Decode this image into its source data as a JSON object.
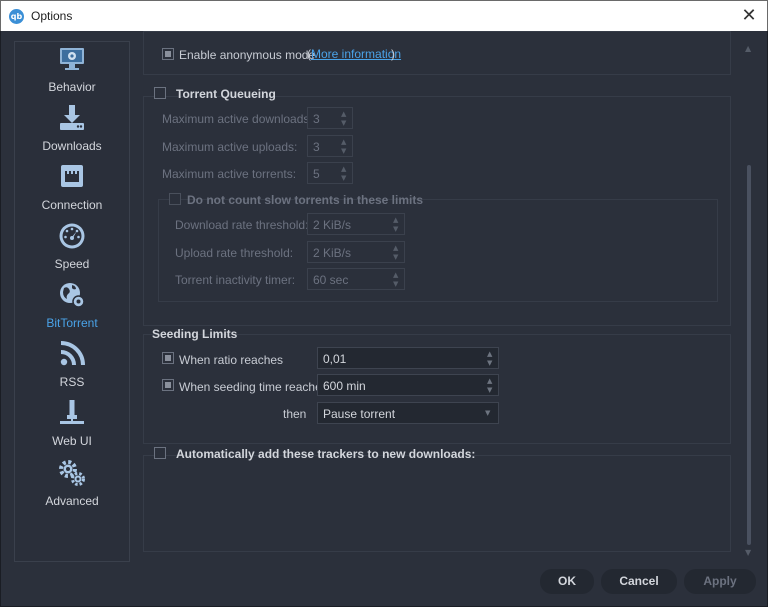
{
  "window": {
    "title": "Options",
    "app_icon_text": "qb",
    "close_glyph": "✕"
  },
  "sidebar": {
    "items": [
      {
        "label": "Behavior",
        "icon": "monitor-gear-icon",
        "active": false
      },
      {
        "label": "Downloads",
        "icon": "download-tray-icon",
        "active": false
      },
      {
        "label": "Connection",
        "icon": "network-port-icon",
        "active": false
      },
      {
        "label": "Speed",
        "icon": "speedometer-icon",
        "active": false
      },
      {
        "label": "BitTorrent",
        "icon": "globe-gear-icon",
        "active": true
      },
      {
        "label": "RSS",
        "icon": "rss-icon",
        "active": false
      },
      {
        "label": "Web UI",
        "icon": "web-ui-plug-icon",
        "active": false
      },
      {
        "label": "Advanced",
        "icon": "gears-icon",
        "active": false
      }
    ],
    "active_color": "#4aa3e8"
  },
  "privacy": {
    "anonymous_mode_label": "Enable anonymous mode",
    "anonymous_mode_checked": true,
    "open_paren": "(",
    "more_info_link": "More information",
    "close_paren": ")"
  },
  "queueing": {
    "title": "Torrent Queueing",
    "checked": false,
    "max_downloads_label": "Maximum active downloads:",
    "max_downloads_value": "3",
    "max_uploads_label": "Maximum active uploads:",
    "max_uploads_value": "3",
    "max_torrents_label": "Maximum active torrents:",
    "max_torrents_value": "5",
    "slow": {
      "title": "Do not count slow torrents in these limits",
      "checked": false,
      "download_rate_label": "Download rate threshold:",
      "download_rate_value": "2 KiB/s",
      "upload_rate_label": "Upload rate threshold:",
      "upload_rate_value": "2 KiB/s",
      "inactivity_label": "Torrent inactivity timer:",
      "inactivity_value": "60 sec"
    }
  },
  "seeding": {
    "title": "Seeding Limits",
    "ratio_label": "When ratio reaches",
    "ratio_checked": true,
    "ratio_value": "0,01",
    "time_label": "When seeding time reaches",
    "time_checked": true,
    "time_value": "600 min",
    "then_label": "then",
    "action_value": "Pause torrent"
  },
  "trackers": {
    "title": "Automatically add these trackers to new downloads:",
    "checked": false
  },
  "buttons": {
    "ok": "OK",
    "cancel": "Cancel",
    "apply": "Apply",
    "apply_enabled": false
  }
}
